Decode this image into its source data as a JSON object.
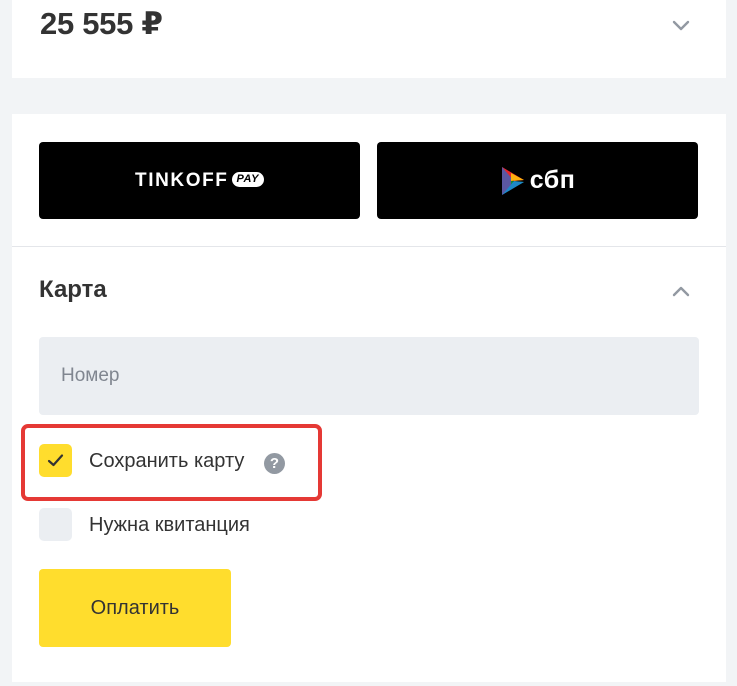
{
  "order": {
    "amount": "25 555 ₽",
    "expand_icon": "chevron-down-icon"
  },
  "quick_pay": {
    "tinkoff": {
      "word": "TINKOFF",
      "badge": "PAY"
    },
    "sbp": {
      "word": "сбп",
      "icon": "sbp-logo-icon"
    }
  },
  "card_section": {
    "title": "Карта",
    "collapse_icon": "chevron-up-icon",
    "number_placeholder": "Номер",
    "number_value": "",
    "save_card": {
      "label": "Сохранить карту",
      "checked": true,
      "help_glyph": "?"
    },
    "receipt": {
      "label": "Нужна квитанция",
      "checked": false
    },
    "submit_label": "Оплатить"
  },
  "colors": {
    "accent_yellow": "#ffdd2d",
    "field_background": "#ebeef2",
    "highlight_red": "#e53935",
    "page_background": "#f2f4f6"
  }
}
